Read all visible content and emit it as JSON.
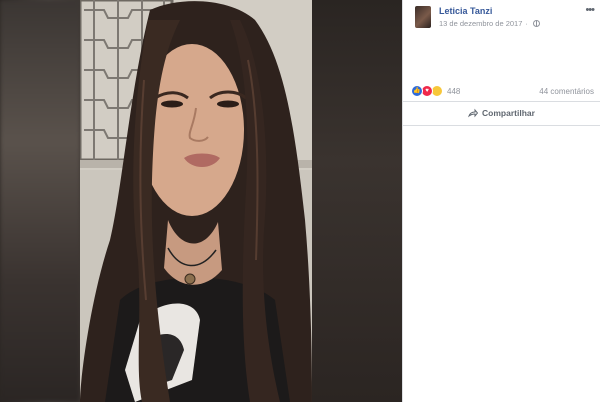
{
  "post": {
    "author": "Leticia Tanzi",
    "date": "13 de dezembro de 2017",
    "separator": "·",
    "more": "•••"
  },
  "reactions": {
    "count": "448",
    "comments": "44 comentários",
    "icons": [
      "like-icon",
      "love-icon",
      "wow-icon"
    ]
  },
  "actions": {
    "share_label": "Compartilhar"
  },
  "colors": {
    "link_blue": "#365899",
    "panel_bg": "#ffffff",
    "viewer_bg": "#1a1a1a",
    "like": "#2f6bd9",
    "love": "#f0284a",
    "wow": "#f7c73a"
  }
}
